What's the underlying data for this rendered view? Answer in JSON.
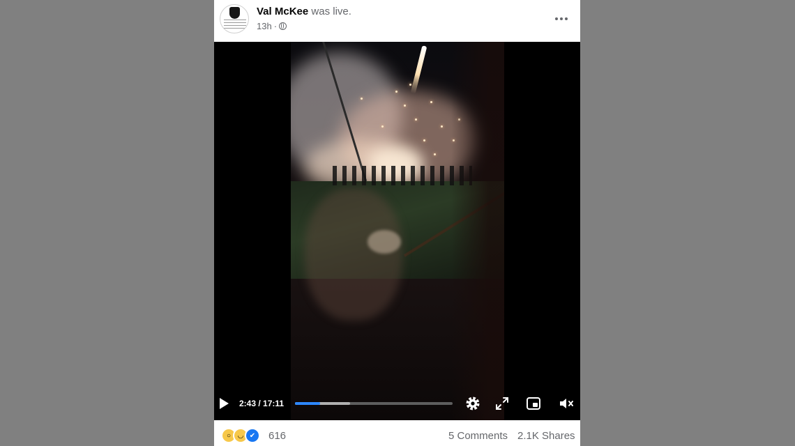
{
  "post": {
    "author": "Val McKee",
    "action": "was live.",
    "timestamp": "13h",
    "separator": "·",
    "privacy_icon": "globe-icon",
    "more_icon": "more-horizontal-icon"
  },
  "video": {
    "current_time": "2:43",
    "duration": "17:11",
    "time_display": "2:43 / 17:11",
    "progress_fraction": 0.158,
    "buffered_fraction": 0.35,
    "icons": [
      "play-icon",
      "settings-icon",
      "fullscreen-icon",
      "picture-in-picture-icon",
      "volume-muted-icon"
    ]
  },
  "footer": {
    "reactions": [
      "wow-reaction-icon",
      "haha-reaction-icon",
      "like-reaction-icon"
    ],
    "reaction_count": "616",
    "comments": "5 Comments",
    "shares": "2.1K Shares"
  },
  "colors": {
    "page_background": "#808080",
    "accent": "#2d88ff",
    "text_secondary": "#65676b"
  }
}
